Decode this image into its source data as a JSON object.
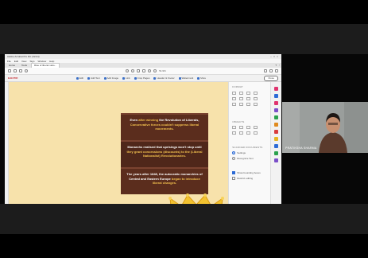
{
  "app": {
    "window_title": "Adobe Acrobat Pro DC (32-bit)",
    "menu": [
      "File",
      "Edit",
      "View",
      "Sign",
      "Window",
      "Help"
    ],
    "tabs": [
      "Home",
      "Tools",
      "Rise of liberal natio..."
    ],
    "zoom": "51.9%"
  },
  "edit_toolbar": {
    "title": "Edit PDF",
    "tools": [
      "Edit",
      "Add Text",
      "Add Image",
      "Link",
      "Crop Pages",
      "Header & Footer",
      "Watermark",
      "More"
    ],
    "close_label": "Close"
  },
  "slide": {
    "brick1": {
      "before": "Even ",
      "em1": "after winning",
      "mid": " the Revolution of Liberals, ",
      "em2": "Conservative forces couldn't suppress liberal movements."
    },
    "brick2": {
      "before": "Monarchs realised that uprisings won't stop until ",
      "em1": "they grant concessions (discounts) to the (Liberal Nationalist) Revolutionaries."
    },
    "brick3": {
      "before": "The years after 1848, the autocratic monarchies of Central and Eastern Europe ",
      "em1": "began to introduce liberal changes."
    }
  },
  "right_panel": {
    "format_heading": "FORMAT",
    "objects_heading": "OBJECTS",
    "scanned_heading": "SCANNED DOCUMENTS",
    "settings_label": "Settings",
    "recognize_label": "Recognize Text",
    "show_bounding_label": "Show bounding boxes",
    "restrict_label": "Restrict editing"
  },
  "webcam": {
    "name": "PRATIKSHA SHARMA"
  },
  "colors": {
    "slide_bg": "#f7e2ab",
    "brick": "#5b2d1d",
    "emphasis": "#f2c14e",
    "crown": "#f2c230",
    "acrobat_red": "#c4252b"
  }
}
